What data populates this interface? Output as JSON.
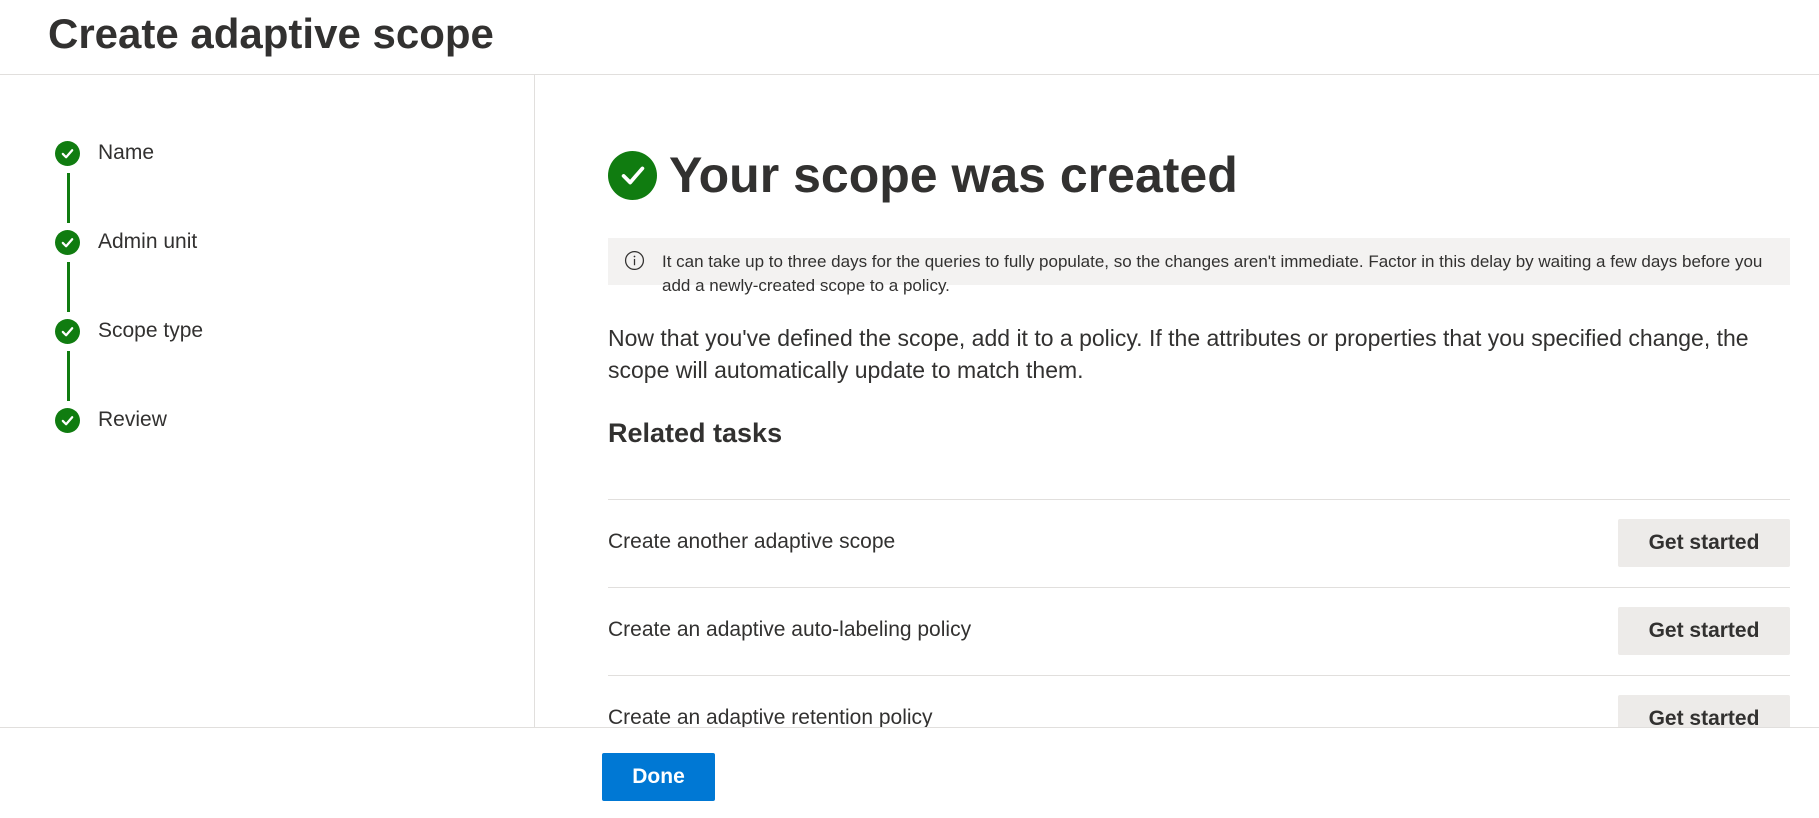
{
  "header": {
    "title": "Create adaptive scope"
  },
  "steps": [
    {
      "label": "Name",
      "status": "completed",
      "icon": "check-circle-icon"
    },
    {
      "label": "Admin unit",
      "status": "completed",
      "icon": "check-circle-icon"
    },
    {
      "label": "Scope type",
      "status": "completed",
      "icon": "check-circle-icon"
    },
    {
      "label": "Review",
      "status": "completed",
      "icon": "check-circle-icon"
    }
  ],
  "main": {
    "title": "Your scope was created",
    "title_icon": "check-circle-icon",
    "info_message": "It can take up to three days for the queries to fully populate, so the changes aren't immediate. Factor in this delay by waiting a few days before you add a newly-created scope to a policy.",
    "info_icon": "info-icon",
    "description": "Now that you've defined the scope, add it to a policy. If the attributes or properties that you specified change, the scope will automatically update to match them.",
    "related_title": "Related tasks",
    "tasks": [
      {
        "label": "Create another adaptive scope",
        "button": "Get started"
      },
      {
        "label": "Create an adaptive auto-labeling policy",
        "button": "Get started"
      },
      {
        "label": "Create an adaptive retention policy",
        "button": "Get started"
      }
    ]
  },
  "footer": {
    "done_label": "Done"
  },
  "colors": {
    "success": "#107c10",
    "primary": "#0078d4",
    "info_background": "#f3f2f1",
    "button_background": "#edebe9",
    "text": "#323130",
    "divider": "#e1dfdd"
  }
}
